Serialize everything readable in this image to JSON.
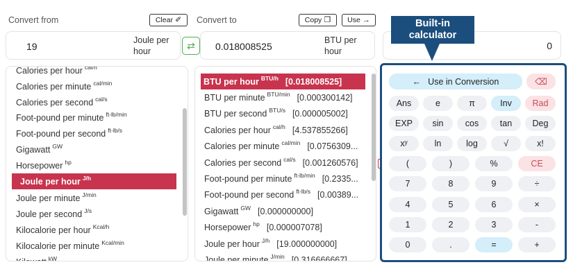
{
  "converter": {
    "from_label": "Convert from",
    "to_label": "Convert to",
    "clear_label": "Clear",
    "copy_label": "Copy",
    "use_label": "Use",
    "from_value": "19",
    "from_unit_line1": "Joule per",
    "from_unit_line2": "hour",
    "to_value": "0.018008525",
    "to_unit_line1": "BTU per",
    "to_unit_line2": "hour",
    "calc_display": "0",
    "icons": {
      "clear": "eraser-icon",
      "copy": "copy-icon",
      "use": "arrow-right-icon",
      "swap": "swap-icon"
    }
  },
  "from_list": [
    {
      "name": "Calories per hour",
      "sup": "cal/h"
    },
    {
      "name": "Calories per minute",
      "sup": "cal/min"
    },
    {
      "name": "Calories per second",
      "sup": "cal/s"
    },
    {
      "name": "Foot-pound per minute",
      "sup": "ft-lb/min"
    },
    {
      "name": "Foot-pound per second",
      "sup": "ft-lb/s"
    },
    {
      "name": "Gigawatt",
      "sup": "GW"
    },
    {
      "name": "Horsepower",
      "sup": "hp"
    },
    {
      "name": "Joule per hour",
      "sup": "J/h",
      "selected": true
    },
    {
      "name": "Joule per minute",
      "sup": "J/min"
    },
    {
      "name": "Joule per second",
      "sup": "J/s"
    },
    {
      "name": "Kilocalorie per hour",
      "sup": "Kcal/h"
    },
    {
      "name": "Kilocalorie per minute",
      "sup": "Kcal/min"
    },
    {
      "name": "Kilowatt",
      "sup": "kW"
    }
  ],
  "to_list": [
    {
      "name": "BTU per hour",
      "sup": "BTU/h",
      "amount": "[0.018008525]",
      "selected": true
    },
    {
      "name": "BTU per minute",
      "sup": "BTU/min",
      "amount": "[0.000300142]"
    },
    {
      "name": "BTU per second",
      "sup": "BTU/s",
      "amount": "[0.000005002]"
    },
    {
      "name": "Calories per hour",
      "sup": "cal/h",
      "amount": "[4.537855266]"
    },
    {
      "name": "Calories per minute",
      "sup": "cal/min",
      "amount": "[0.0756309..."
    },
    {
      "name": "Calories per second",
      "sup": "cal/s",
      "amount": "[0.001260576]"
    },
    {
      "name": "Foot-pound per minute",
      "sup": "ft-lb/min",
      "amount": "[0.2335..."
    },
    {
      "name": "Foot-pound per second",
      "sup": "ft-lb/s",
      "amount": "[0.00389..."
    },
    {
      "name": "Gigawatt",
      "sup": "GW",
      "amount": "[0.000000000]"
    },
    {
      "name": "Horsepower",
      "sup": "hp",
      "amount": "[0.000007078]"
    },
    {
      "name": "Joule per hour",
      "sup": "J/h",
      "amount": "[19.000000000]"
    },
    {
      "name": "Joule per minute",
      "sup": "J/min",
      "amount": "[0.316666667]"
    }
  ],
  "calculator": {
    "use_in_conversion": "Use in Conversion",
    "backspace_icon": "backspace-icon",
    "rows": [
      [
        "Ans",
        "e",
        "π",
        "Inv",
        "Rad"
      ],
      [
        "EXP",
        "sin",
        "cos",
        "tan",
        "Deg"
      ],
      [
        "xʸ",
        "ln",
        "log",
        "√",
        "x!"
      ],
      [
        "(",
        ")",
        "%",
        "CE"
      ],
      [
        "7",
        "8",
        "9",
        "÷"
      ],
      [
        "4",
        "5",
        "6",
        "×"
      ],
      [
        "1",
        "2",
        "3",
        "-"
      ],
      [
        "0",
        ".",
        "=",
        "+"
      ]
    ]
  },
  "callout": {
    "line1": "Built-in",
    "line2": "calculator"
  }
}
